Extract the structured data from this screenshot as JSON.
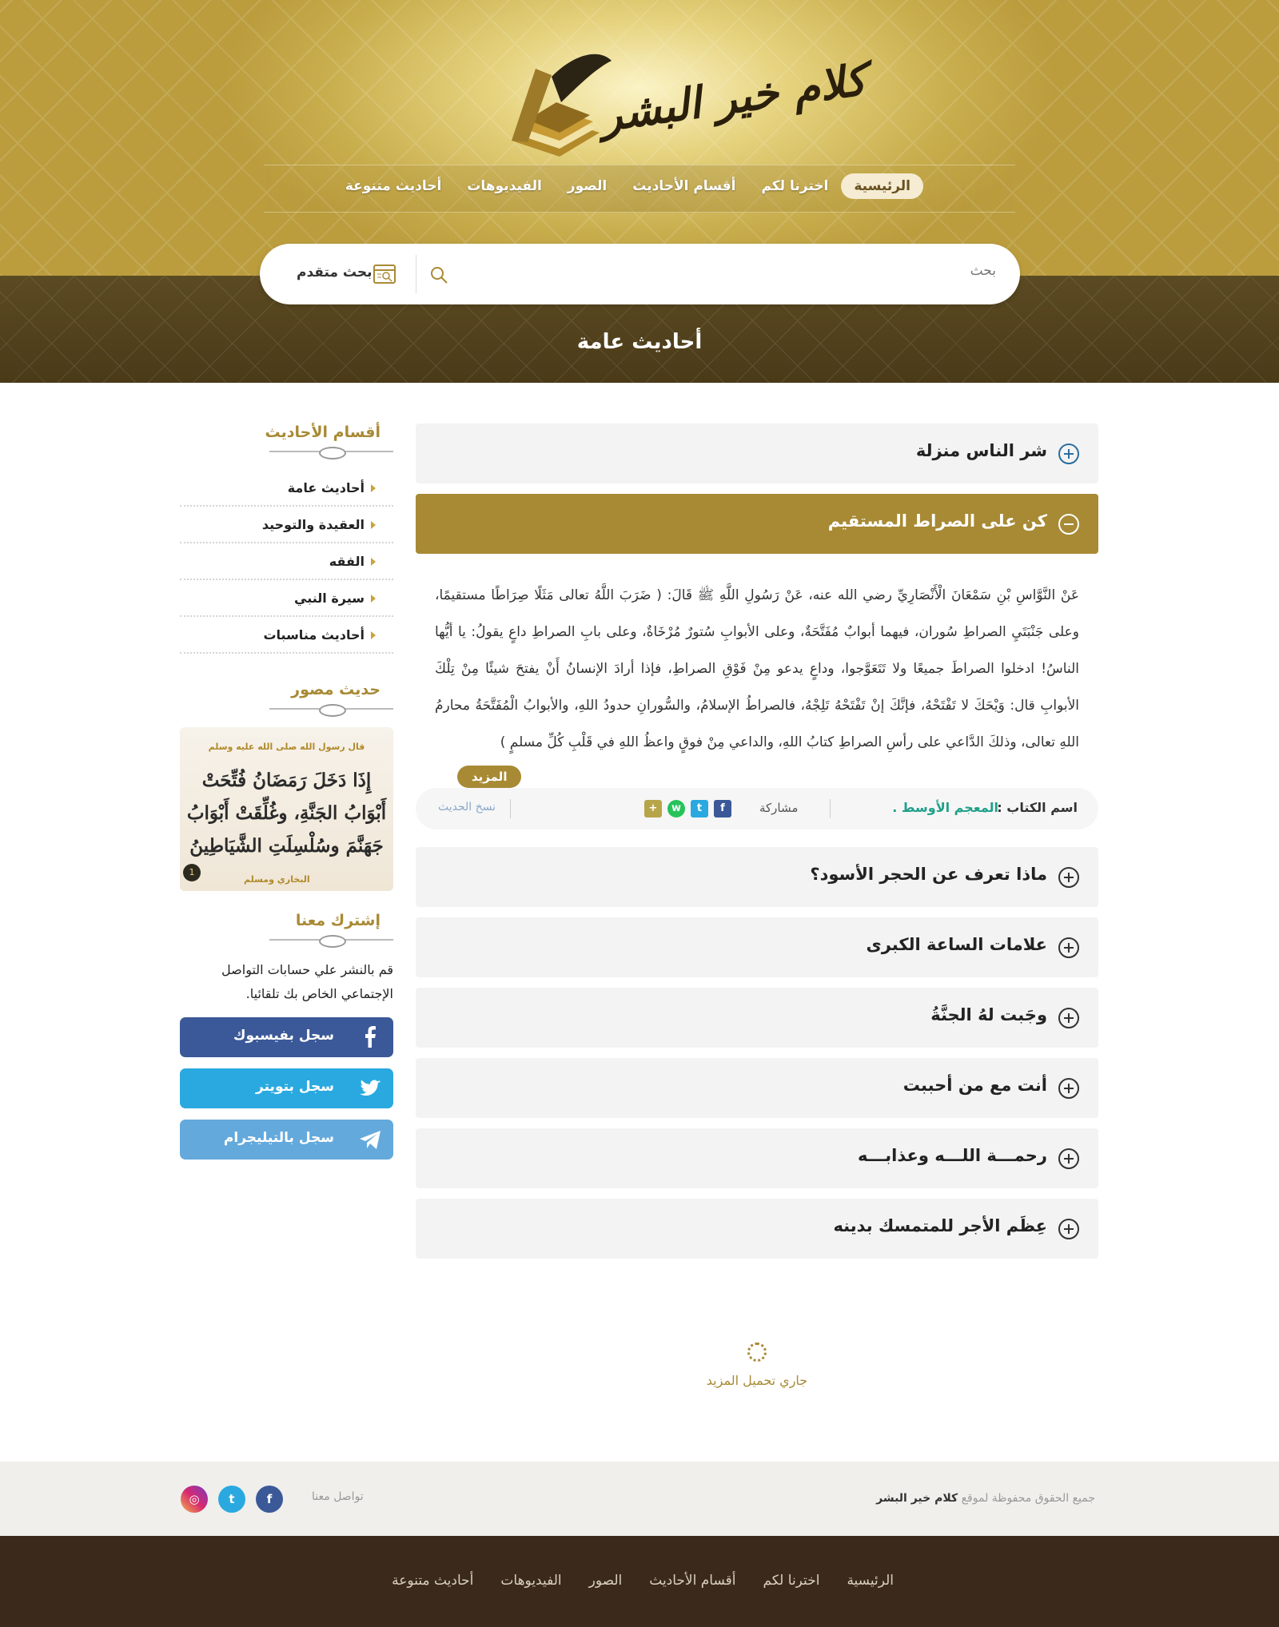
{
  "site": {
    "logo_text": "كلام خير البشر"
  },
  "nav": {
    "items": [
      "الرئيسية",
      "اخترنا لكم",
      "أقسام الأحاديث",
      "الصور",
      "الفيديوهات",
      "أحاديث متنوعة"
    ],
    "active": "الرئيسية"
  },
  "search": {
    "placeholder": "بحث",
    "advanced_label": "بحث متقدم"
  },
  "page": {
    "title": "أحاديث عامة"
  },
  "accordion": {
    "first": "شر الناس منزلة",
    "open": "كن على الصراط المستقيم",
    "rest": [
      "ماذا تعرف عن الحجر الأسود؟",
      "علامات الساعة الكبرى",
      "وجَبت لهُ الجنَّةُ",
      "أنت مع من أحببت",
      "رحمـــة اللـــه وعذابـــه",
      "عِظَم الأجر للمتمسك بدينه"
    ]
  },
  "hadith": {
    "text": "عَنْ النَّوَّاسِ بْنِ سَمْعَانَ الْأَنْصَارِيِّ رضي الله عنه، عَنْ رَسُولِ اللَّهِ ﷺ قَالَ: ( ضَرَبَ اللَّهُ تعالى مَثَلًا صِرَاطًا مستقيمًا، وعلى جَنْبَتَيِ الصراطِ سُوران، فيهما أبوابٌ مُفَتَّحَةٌ، وعلى الأبوابِ سُتورٌ مُرْخَاةٌ، وعلى بابِ الصراطِ داعٍ يقولُ: يا أيُّها الناسُ! ادخلوا الصراطَ جميعًا ولا تَتَعَوَّجوا، وداعٍ يدعو مِنْ فَوْقِ الصراطِ، فإذا أرادَ الإنسانُ أَنْ يفتحَ شيئًا مِنْ تِلْكَ الأبوابِ قال: وَيْحَكَ لا تَفْتَحْهُ، فإنَّكَ إنْ تَفْتَحْهُ تَلِجْهُ، فالصراطُ الإسلامُ، والسُّورانِ حدودُ اللهِ، والأبوابُ الْمُفَتَّحَةُ محارمُ اللهِ تعالى، وذلكَ الدَّاعي على رأسِ الصراطِ كتابُ اللهِ، والداعي مِنْ فوقٍ واعظُ اللهِ في قَلْبِ كُلِّ مسلمٍ )",
    "more_label": "المزيد",
    "book_key": "اسم الكتاب :",
    "book_value": "المعجم الأوسط .",
    "share_label": "مشاركة",
    "copy_label": "نسخ الحديث"
  },
  "loader": {
    "text": "جاري تحميل المزيد"
  },
  "sidebar": {
    "categories_title": "أقسام الأحاديث",
    "categories": [
      "أحاديث عامة",
      "العقيدة والتوحيد",
      "الفقه",
      "سيرة النبي",
      "أحاديث مناسبات"
    ],
    "pic_title": "حديث مصور",
    "pic_small": "قال رسول الله صلى الله عليه وسلم",
    "pic_big": "إِذَا دَخَلَ رَمَضَانُ فُتِّحَتْ أَبْوَابُ الجَنَّةِ، وغُلِّقَتْ أَبْوَابُ جَهَنَّمَ وسُلْسِلَتِ الشَّيَاطِينُ",
    "pic_source": "البخاري ومسلم",
    "pic_badge": "1",
    "subscribe_title": "إشترك معنا",
    "subscribe_text": "قم بالنشر علي حسابات التواصل الإجتماعي الخاص بك تلقائيا.",
    "facebook_label": "سجل بفيسبوك",
    "twitter_label": "سجل بتويتر",
    "telegram_label": "سجل بالتيليجرام"
  },
  "footer": {
    "copyright_prefix": "جميع الحقوق محفوظة لموقع",
    "copyright_site": "كلام خير البشر",
    "contact_label": "تواصل معنا",
    "nav": [
      "الرئيسية",
      "اخترنا لكم",
      "أقسام الأحاديث",
      "الصور",
      "الفيديوهات",
      "أحاديث متنوعة"
    ]
  },
  "colors": {
    "gold": "#a88a35",
    "facebook": "#3b5998",
    "twitter": "#2aa9e0",
    "telegram": "#64a9dc",
    "footer_dark": "#3b2a1b"
  }
}
